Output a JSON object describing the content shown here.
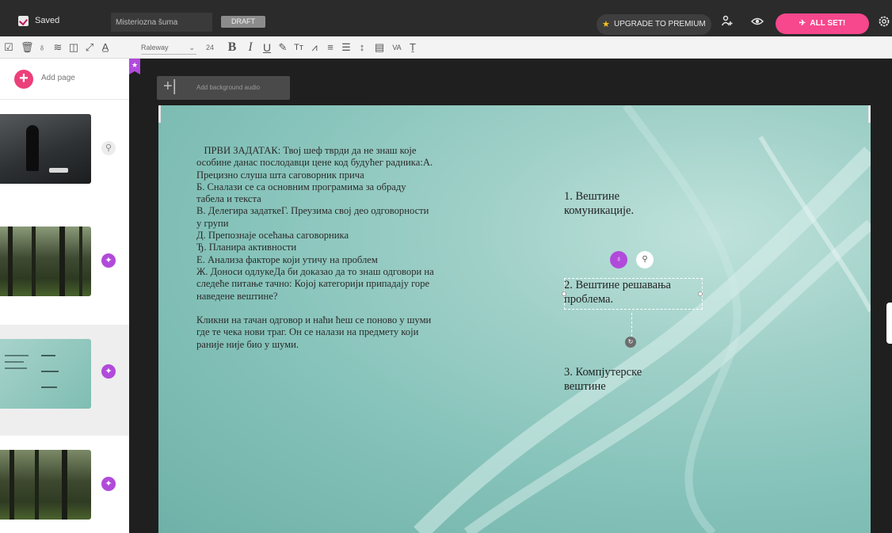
{
  "topbar": {
    "saved_label": "Saved",
    "title_value": "Misteriozna šuma",
    "draft_label": "DRAFT",
    "upgrade_label": "UPGRADE TO PREMIUM",
    "allset_label": "ALL SET!"
  },
  "toolbar": {
    "font_family": "Raleway",
    "font_size": "24"
  },
  "sidebar": {
    "add_page_label": "Add page"
  },
  "audio": {
    "label": "Add background audio"
  },
  "slide": {
    "left_text": "   ПРВИ ЗАДАТАК: Твој шеф тврди да не знаш које особине данас послодавци цене код будућег радника:А. Прецизно слуша шта саговорник прича\nБ. Сналази се са основним програмима за обраду табела и текста\nВ. Делегира задаткеГ. Преузима свој део одговорности у групи\nД. Препознаје осећања саговорника\nЂ. Планира активности\nЕ. Анализа факторе који утичу на проблем\nЖ. Доноси одлукеДа би доказао да то знаш одговори на следеће питање тачно: Којој категорији припадају горе наведене вештине?\n\nКликни на тачан одговор и наћи ћеш се поново у шуми где те чека нови траг. Он се налази на предмету који раније није био у шуми.",
    "option1": "1. Вештине комуникације.",
    "option2": "2. Вештине решавања проблема.",
    "option3": "3. Компјутерске вештине"
  },
  "colors": {
    "accent_pink": "#f7478d",
    "magic_purple": "#b14adb",
    "slide_teal": "#86c3ba"
  }
}
